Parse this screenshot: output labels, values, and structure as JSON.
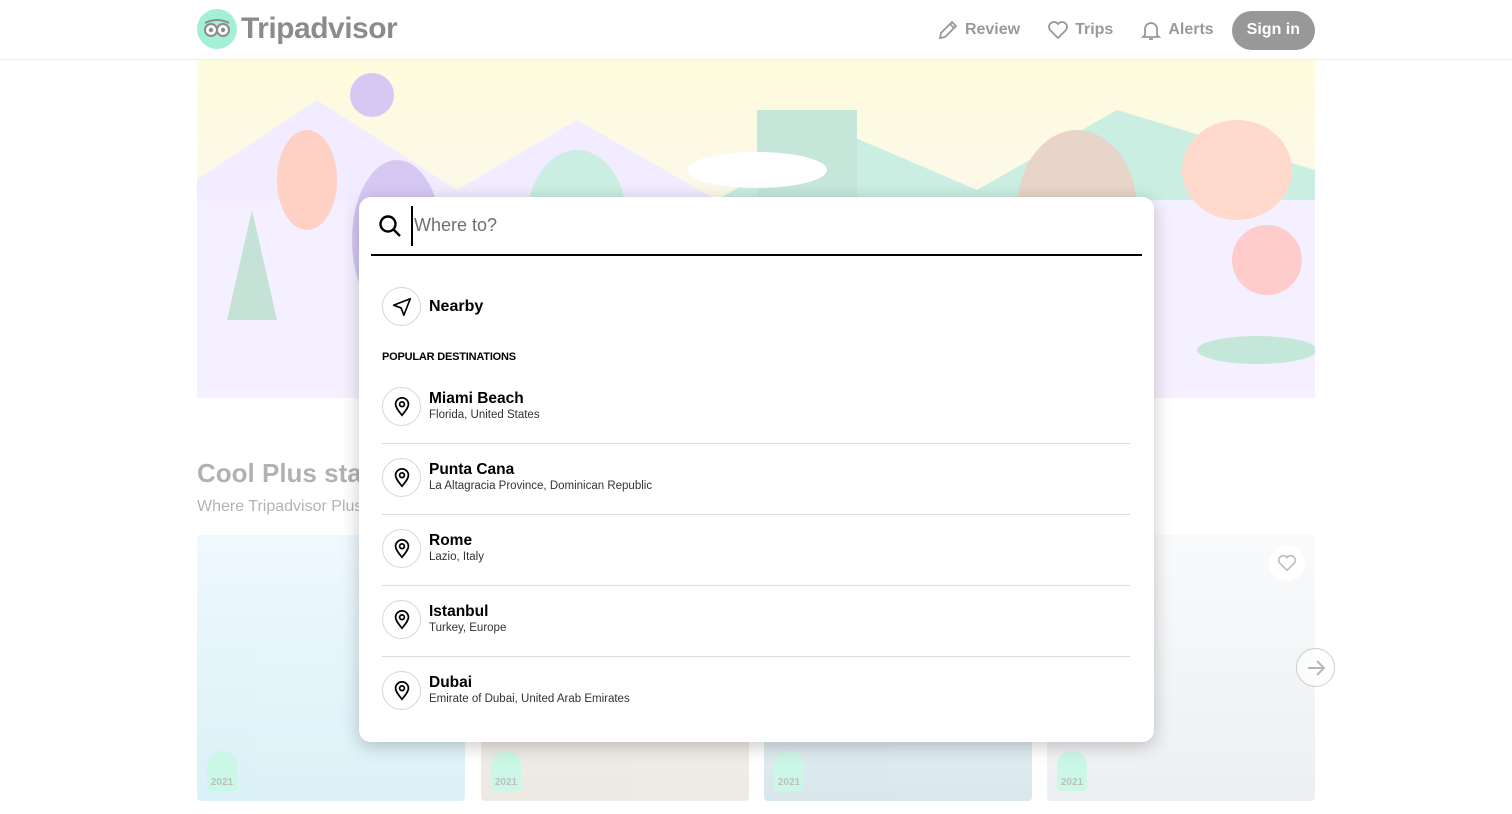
{
  "header": {
    "logo_text": "Tripadvisor",
    "nav": [
      {
        "label": "Review",
        "icon": "pencil-icon"
      },
      {
        "label": "Trips",
        "icon": "heart-icon"
      },
      {
        "label": "Alerts",
        "icon": "bell-icon"
      }
    ],
    "signin_label": "Sign in"
  },
  "section": {
    "title": "Cool Plus stays",
    "subtitle": "Where Tripadvisor Plus"
  },
  "cards": [
    {
      "award_year": "2021"
    },
    {
      "award_year": "2021"
    },
    {
      "award_year": "2021"
    },
    {
      "award_year": "2021"
    }
  ],
  "search": {
    "placeholder": "Where to?",
    "value": "",
    "nearby_label": "Nearby",
    "popular_heading": "POPULAR DESTINATIONS",
    "destinations": [
      {
        "name": "Miami Beach",
        "region": "Florida, United States"
      },
      {
        "name": "Punta Cana",
        "region": "La Altagracia Province, Dominican Republic"
      },
      {
        "name": "Rome",
        "region": "Lazio, Italy"
      },
      {
        "name": "Istanbul",
        "region": "Turkey, Europe"
      },
      {
        "name": "Dubai",
        "region": "Emirate of Dubai, United Arab Emirates"
      }
    ]
  },
  "colors": {
    "brand": "#34e0a1",
    "text": "#000000",
    "divider": "#dcdcdc"
  }
}
